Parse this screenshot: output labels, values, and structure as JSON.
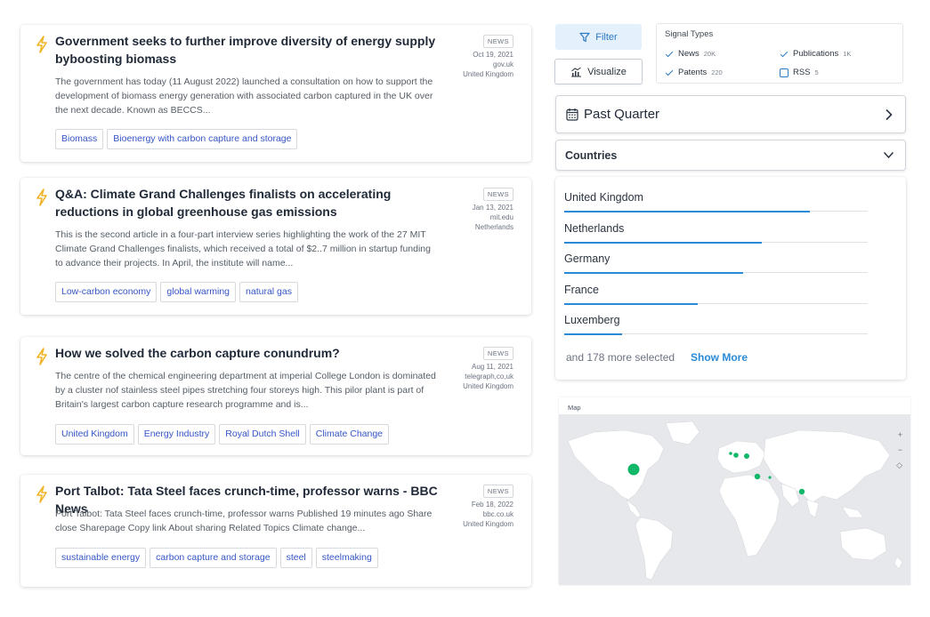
{
  "articles": [
    {
      "title": "Government seeks to further improve diversity  of energy supply byboosting biomass",
      "snippet": "The government has today (11 August 2022) launched a consultation on how to support the development of biomass energy generation with associated carbon captured in the UK over the next decade. Known as BECCS...",
      "type": "NEWS",
      "date": "Oct 19, 2021",
      "source": "gov.uk",
      "country": "United Kingdom",
      "tags": [
        "Biomass",
        "Bioenergy with carbon capture and storage"
      ]
    },
    {
      "title": "Q&A: Climate Grand Challenges finalists on accelerating reductions in global greenhouse gas emissions",
      "snippet": "This is the second article in a four-part interview series highlighting the work of the 27 MIT Climate Grand Challenges finalists, which received a total of $2..7 million in startup funding to advance their projects. In April, the institute will name...",
      "type": "NEWS",
      "date": "Jan 13, 2021",
      "source": "mit.edu",
      "country": "Netherlands",
      "tags": [
        "Low-carbon economy",
        "global warming",
        "natural gas"
      ]
    },
    {
      "title": "How we solved the carbon capture conundrum?",
      "snippet": "The centre of the chemical engineering department at imperial College London is dominated by a cluster nof stainless steel pipes stretching four storeys high. This pilor plant is part of Britain's largest carbon capture research programme and is...",
      "type": "NEWS",
      "date": "Aug 11, 2021",
      "source": "telegraph,co,uk",
      "country": "United Kingdom",
      "tags": [
        "United Kingdom",
        "Energy Industry",
        "Royal Dutch Shell",
        "Climate Change"
      ]
    },
    {
      "title": "Port Talbot: Tata Steel faces crunch-time, professor warns - BBC News",
      "snippet": "Port Talbot: Tata Steel faces crunch-time, professor warns Published 19 minutes ago Share close Sharepage Copy link About sharing Related Topics Climate change...",
      "type": "NEWS",
      "date": "Feb 18, 2022",
      "source": "bbc.co.uk",
      "country": "United Kingdom",
      "tags": [
        "sustainable energy",
        "carbon capture and storage",
        "steel",
        "steelmaking"
      ]
    }
  ],
  "toolbar": {
    "filter_label": "Filter",
    "visualize_label": "Visualize"
  },
  "signal_types": {
    "title": "Signal Types",
    "items": [
      {
        "label": "News",
        "count": "20K",
        "checked": true
      },
      {
        "label": "Publications",
        "count": "1K",
        "checked": true
      },
      {
        "label": "Patents",
        "count": "220",
        "checked": true
      },
      {
        "label": "RSS",
        "count": "5",
        "checked": false
      }
    ]
  },
  "period": {
    "label": "Past Quarter"
  },
  "countries": {
    "label": "Countries",
    "items": [
      {
        "name": "United Kingdom",
        "share": 0.81
      },
      {
        "name": "Netherlands",
        "share": 0.65
      },
      {
        "name": "Germany",
        "share": 0.59
      },
      {
        "name": "France",
        "share": 0.44
      },
      {
        "name": "Luxemberg",
        "share": 0.19
      }
    ],
    "more_text": "and 178 more selected",
    "show_more_label": "Show More"
  },
  "map": {
    "label": "Map",
    "zoom_in": "+",
    "zoom_out": "−",
    "reset": "◇"
  },
  "colors": {
    "accent": "#2a8ad6",
    "tag_text": "#3556c7",
    "bolt": "#f0b429",
    "map_dot": "#12b76a"
  }
}
